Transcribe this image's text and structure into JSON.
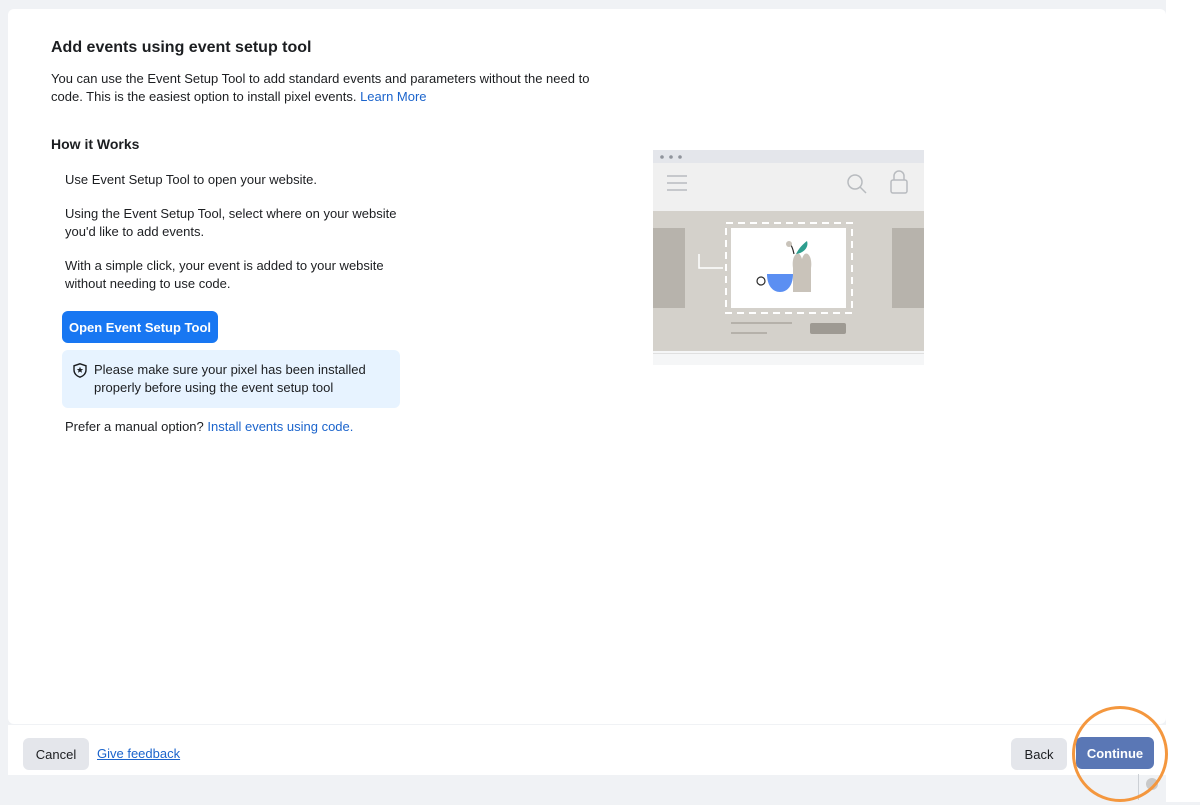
{
  "header": {
    "title": "Add events using event setup tool",
    "intro_text": "You can use the Event Setup Tool to add standard events and parameters without the need to code. This is the easiest option to install pixel events.",
    "learn_more": "Learn More"
  },
  "how_it_works": {
    "title": "How it Works",
    "steps": [
      "Use Event Setup Tool to open your website.",
      "Using the Event Setup Tool, select where on your website you'd like to add events.",
      "With a simple click, your event is added to your website without needing to use code."
    ],
    "open_button": "Open Event Setup Tool",
    "notice": "Please make sure your pixel has been installed properly before using the event setup tool",
    "manual_prompt": "Prefer a manual option?",
    "manual_link": "Install events using code."
  },
  "footer": {
    "cancel": "Cancel",
    "feedback": "Give feedback",
    "back": "Back",
    "continue": "Continue"
  },
  "colors": {
    "primary": "#1877f2",
    "continue": "#5a77b5",
    "link": "#1b64cc",
    "notice_bg": "#e7f3ff",
    "highlight": "#f4973e"
  }
}
